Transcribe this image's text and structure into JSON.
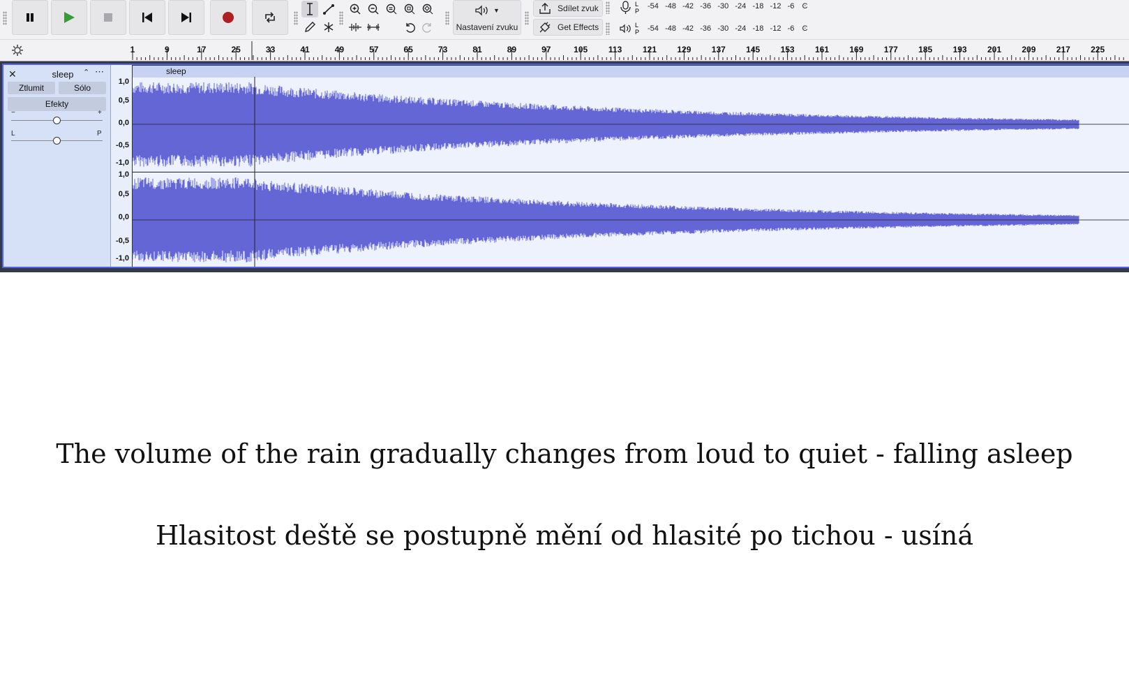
{
  "transport": {
    "pause_icon": "pause-icon",
    "play_icon": "play-icon",
    "stop_icon": "stop-icon",
    "skip_start_icon": "skip-to-start-icon",
    "skip_end_icon": "skip-to-end-icon",
    "record_icon": "record-icon",
    "loop_icon": "loop-icon",
    "play_color": "#3a9a3a",
    "record_color": "#b02020"
  },
  "audio_setup": {
    "label": "Nastavení zvuku"
  },
  "share": {
    "share_label": "Sdílet zvuk",
    "effects_label": "Get Effects"
  },
  "meters": {
    "record_lr": [
      "L",
      "P"
    ],
    "play_lr": [
      "L",
      "P"
    ],
    "scale": [
      "-54",
      "-48",
      "-42",
      "-36",
      "-30",
      "-24",
      "-18",
      "-12",
      "-6"
    ]
  },
  "ruler": {
    "ticks": [
      "1",
      "9",
      "17",
      "25",
      "33",
      "41",
      "49",
      "57",
      "65",
      "73",
      "81",
      "89",
      "97",
      "105",
      "113",
      "121",
      "129",
      "137",
      "145",
      "153",
      "161",
      "169",
      "177",
      "185",
      "193",
      "201",
      "209",
      "217",
      "225"
    ]
  },
  "track": {
    "name": "sleep",
    "mute_label": "Ztlumit",
    "solo_label": "Sólo",
    "effects_label": "Efekty",
    "gain_minus": "−",
    "gain_plus": "+",
    "pan_left": "L",
    "pan_right": "P",
    "clip_name": "sleep",
    "scale_labels": [
      "1,0",
      "0,5",
      "0,0",
      "-0,5",
      "-1,0"
    ],
    "waveform_color": "#6466d6",
    "gain_level": 0.5,
    "pan_level": 0.5
  },
  "captions": {
    "english": "The volume of the rain gradually changes from loud to quiet - falling asleep",
    "czech": "Hlasitost deště se postupně mění od hlasité po tichou - usíná"
  }
}
